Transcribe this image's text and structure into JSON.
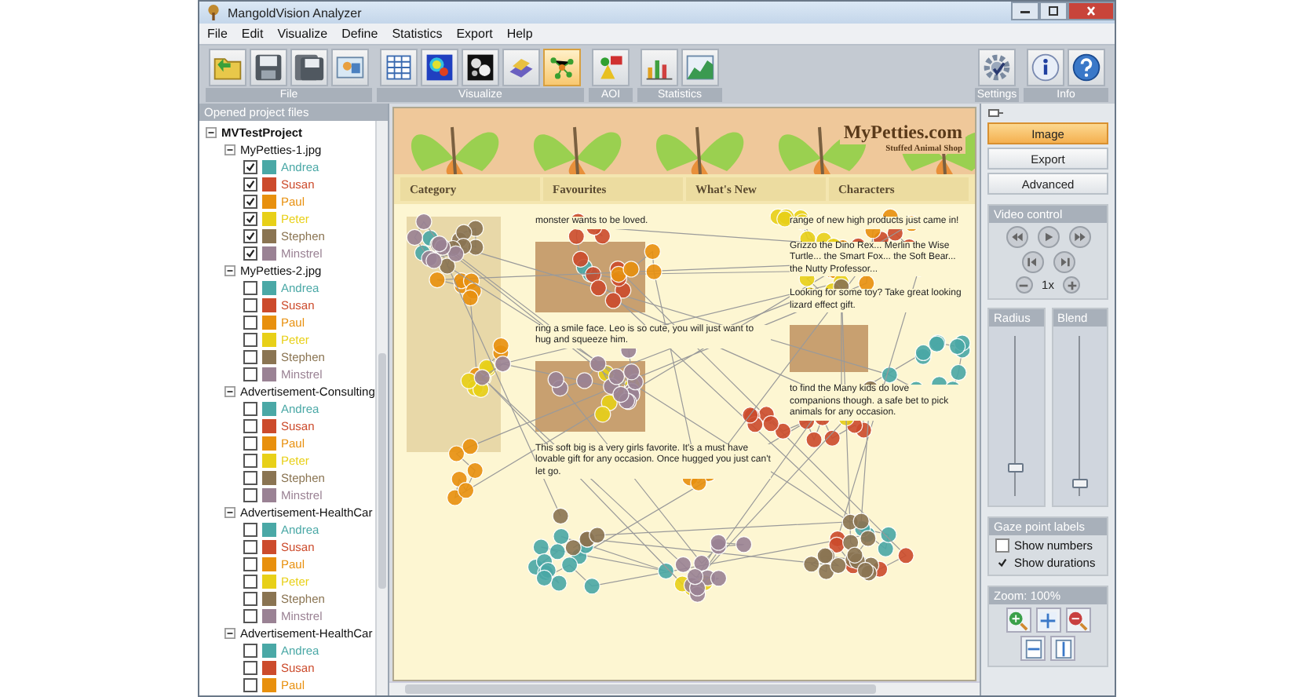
{
  "window": {
    "title": "MangoldVision Analyzer"
  },
  "menu": [
    "File",
    "Edit",
    "Visualize",
    "Define",
    "Statistics",
    "Export",
    "Help"
  ],
  "toolbar": {
    "groups": [
      {
        "label": "File",
        "buttons": [
          {
            "selected": false
          },
          {
            "selected": false
          },
          {
            "selected": false
          },
          {
            "selected": false
          }
        ]
      },
      {
        "label": "Visualize",
        "buttons": [
          {
            "selected": false
          },
          {
            "selected": false
          },
          {
            "selected": false
          },
          {
            "selected": false
          },
          {
            "selected": true
          }
        ]
      },
      {
        "label": "AOI",
        "buttons": [
          {
            "selected": false
          }
        ]
      },
      {
        "label": "Statistics",
        "buttons": [
          {
            "selected": false
          },
          {
            "selected": false
          }
        ]
      }
    ],
    "right_groups": [
      {
        "label": "Settings",
        "buttons": [
          {
            "selected": false
          }
        ]
      },
      {
        "label": "Info",
        "buttons": [
          {
            "selected": false
          },
          {
            "selected": false
          }
        ]
      }
    ]
  },
  "project_panel": {
    "title": "Opened project files",
    "project": {
      "name": "MVTestProject",
      "expanded": true,
      "children": [
        {
          "name": "MyPetties-1.jpg",
          "expanded": true,
          "children": [
            {
              "name": "Andrea",
              "checked": true,
              "color": "#4aa8a6"
            },
            {
              "name": "Susan",
              "checked": true,
              "color": "#cc4b2c"
            },
            {
              "name": "Paul",
              "checked": true,
              "color": "#e8900e"
            },
            {
              "name": "Peter",
              "checked": true,
              "color": "#e8d018"
            },
            {
              "name": "Stephen",
              "checked": true,
              "color": "#8a7452"
            },
            {
              "name": "Minstrel",
              "checked": true,
              "color": "#9a8294"
            }
          ]
        },
        {
          "name": "MyPetties-2.jpg",
          "expanded": true,
          "children": [
            {
              "name": "Andrea",
              "checked": false,
              "color": "#4aa8a6"
            },
            {
              "name": "Susan",
              "checked": false,
              "color": "#cc4b2c"
            },
            {
              "name": "Paul",
              "checked": false,
              "color": "#e8900e"
            },
            {
              "name": "Peter",
              "checked": false,
              "color": "#e8d018"
            },
            {
              "name": "Stephen",
              "checked": false,
              "color": "#8a7452"
            },
            {
              "name": "Minstrel",
              "checked": false,
              "color": "#9a8294"
            }
          ]
        },
        {
          "name": "Advertisement-Consulting",
          "expanded": true,
          "children": [
            {
              "name": "Andrea",
              "checked": false,
              "color": "#4aa8a6"
            },
            {
              "name": "Susan",
              "checked": false,
              "color": "#cc4b2c"
            },
            {
              "name": "Paul",
              "checked": false,
              "color": "#e8900e"
            },
            {
              "name": "Peter",
              "checked": false,
              "color": "#e8d018"
            },
            {
              "name": "Stephen",
              "checked": false,
              "color": "#8a7452"
            },
            {
              "name": "Minstrel",
              "checked": false,
              "color": "#9a8294"
            }
          ]
        },
        {
          "name": "Advertisement-HealthCar",
          "expanded": true,
          "children": [
            {
              "name": "Andrea",
              "checked": false,
              "color": "#4aa8a6"
            },
            {
              "name": "Susan",
              "checked": false,
              "color": "#cc4b2c"
            },
            {
              "name": "Paul",
              "checked": false,
              "color": "#e8900e"
            },
            {
              "name": "Peter",
              "checked": false,
              "color": "#e8d018"
            },
            {
              "name": "Stephen",
              "checked": false,
              "color": "#8a7452"
            },
            {
              "name": "Minstrel",
              "checked": false,
              "color": "#9a8294"
            }
          ]
        },
        {
          "name": "Advertisement-HealthCar",
          "expanded": true,
          "children": [
            {
              "name": "Andrea",
              "checked": false,
              "color": "#4aa8a6"
            },
            {
              "name": "Susan",
              "checked": false,
              "color": "#cc4b2c"
            },
            {
              "name": "Paul",
              "checked": false,
              "color": "#e8900e"
            }
          ]
        }
      ]
    }
  },
  "stimulus": {
    "site_title": "MyPetties.com",
    "tagline": "Stuffed Animal Shop",
    "nav": [
      "Category",
      "Favourites",
      "What's New",
      "Characters"
    ],
    "text_blocks": [
      "monster wants to be loved.",
      "ring a smile face. Leo is so cute, you will just want to hug and squeeze him.",
      "This soft big is a very girls favorite. It's a must have lovable gift for any occasion. Once hugged you just can't let go.",
      "range of new high products just came in!",
      "Grizzo the Dino Rex... Merlin the Wise Turtle... the Smart Fox... the Soft Bear... the Nutty Professor...",
      "Looking for some toy? Take great looking lizard effect gift.",
      "to find the Many kids do love companions though. a safe bet to pick animals for any occasion."
    ]
  },
  "side_panel": {
    "tabs": [
      {
        "label": "Image",
        "selected": true
      },
      {
        "label": "Export",
        "selected": false
      },
      {
        "label": "Advanced",
        "selected": false
      }
    ],
    "video_control": {
      "title": "Video control",
      "speed": "1x"
    },
    "sliders": [
      {
        "label": "Radius",
        "level": 0.15
      },
      {
        "label": "Blend",
        "level": 0.05
      }
    ],
    "gaze_point_labels": {
      "title": "Gaze point labels",
      "options": [
        {
          "label": "Show numbers",
          "checked": false
        },
        {
          "label": "Show durations",
          "checked": true
        }
      ]
    },
    "zoom": {
      "title": "Zoom: 100%"
    }
  }
}
